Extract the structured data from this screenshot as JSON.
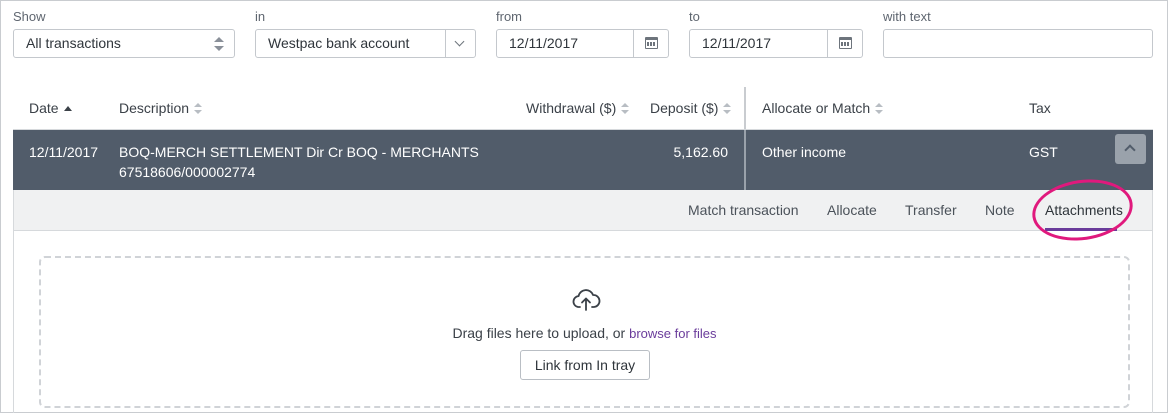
{
  "filters": {
    "show": {
      "label": "Show",
      "value": "All transactions"
    },
    "in": {
      "label": "in",
      "value": "Westpac bank account"
    },
    "from": {
      "label": "from",
      "value": "12/11/2017"
    },
    "to": {
      "label": "to",
      "value": "12/11/2017"
    },
    "with_text": {
      "label": "with text",
      "value": ""
    }
  },
  "table": {
    "columns": {
      "date": "Date",
      "description": "Description",
      "withdrawal": "Withdrawal ($)",
      "deposit": "Deposit ($)",
      "allocate": "Allocate or Match",
      "tax": "Tax"
    },
    "selected_row": {
      "date": "12/11/2017",
      "description_line1": "BOQ-MERCH SETTLEMENT Dir Cr BOQ - MERCHANTS",
      "description_line2": "67518606/000002774",
      "withdrawal": "",
      "deposit": "5,162.60",
      "allocate": "Other income",
      "tax": "GST"
    }
  },
  "tabs": {
    "match": "Match transaction",
    "allocate": "Allocate",
    "transfer": "Transfer",
    "note": "Note",
    "attachments": "Attachments",
    "active": "Attachments"
  },
  "upload": {
    "prompt": "Drag files here to upload, or",
    "browse_link": "browse for files",
    "link_button": "Link from In tray"
  },
  "colors": {
    "selected_row_bg": "#515c6a",
    "accent": "#6a3c9b",
    "annotation": "#e0197d"
  }
}
